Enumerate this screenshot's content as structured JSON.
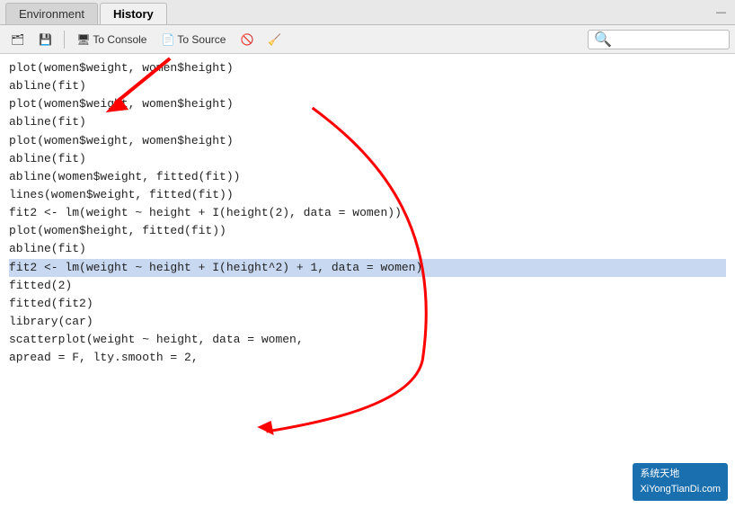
{
  "tabs": [
    {
      "id": "environment",
      "label": "Environment",
      "active": false
    },
    {
      "id": "history",
      "label": "History",
      "active": true
    }
  ],
  "toolbar": {
    "btn_open_label": "🗂",
    "btn_save_label": "💾",
    "btn_to_console_label": "To Console",
    "btn_to_source_label": "To Source",
    "btn_delete_label": "🚫",
    "btn_broom_label": "🧹",
    "search_placeholder": "🔍"
  },
  "code_lines": [
    {
      "text": "plot(women$weight, women$height)",
      "selected": false
    },
    {
      "text": "abline(fit)",
      "selected": false
    },
    {
      "text": "plot(women$weight, women$height)",
      "selected": false
    },
    {
      "text": "abline(fit)",
      "selected": false
    },
    {
      "text": "plot(women$weight, women$height)",
      "selected": false
    },
    {
      "text": "abline(fit)",
      "selected": false
    },
    {
      "text": "abline(women$weight, fitted(fit))",
      "selected": false
    },
    {
      "text": "lines(women$weight, fitted(fit))",
      "selected": false
    },
    {
      "text": "fit2 <- lm(weight ~ height + I(height(2), data = women))",
      "selected": false
    },
    {
      "text": "plot(women$height, fitted(fit))",
      "selected": false
    },
    {
      "text": "abline(fit)",
      "selected": false
    },
    {
      "text": "fit2 <- lm(weight ~ height + I(height^2) + 1, data = women)",
      "selected": true
    },
    {
      "text": "fitted(2)",
      "selected": false
    },
    {
      "text": "fitted(fit2)",
      "selected": false
    },
    {
      "text": "library(car)",
      "selected": false
    },
    {
      "text": "scatterplot(weight ~ height, data = women,",
      "selected": false
    },
    {
      "text": "apread = F, lty.smooth = 2,",
      "selected": false
    }
  ],
  "watermark": {
    "line1": "系统天地",
    "line2": "XiYongTianDi.com"
  },
  "minimize_label": "—"
}
